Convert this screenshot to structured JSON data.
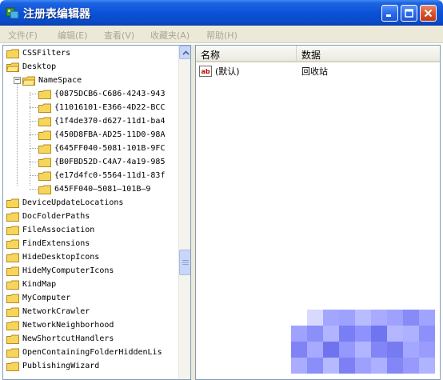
{
  "window": {
    "title": "注册表编辑器",
    "icon": "regedit-icon"
  },
  "menu": [
    "文件(F)",
    "编辑(E)",
    "查看(V)",
    "收藏夹(A)",
    "帮助(H)"
  ],
  "tree": [
    {
      "label": "CSSFilters",
      "level": 0
    },
    {
      "label": "Desktop",
      "level": 0
    },
    {
      "label": "NameSpace",
      "level": 1
    },
    {
      "label": "{0875DCB6-C686-4243-943",
      "level": 2
    },
    {
      "label": "{11016101-E366-4D22-BCC",
      "level": 2
    },
    {
      "label": "{1f4de370-d627-11d1-ba4",
      "level": 2
    },
    {
      "label": "{450D8FBA-AD25-11D0-98A",
      "level": 2
    },
    {
      "label": "{645FF040-5081-101B-9FC",
      "level": 2
    },
    {
      "label": "{B0FBD52D-C4A7-4a19-985",
      "level": 2
    },
    {
      "label": "{e17d4fc0-5564-11d1-83f",
      "level": 2
    },
    {
      "label": "645FF040—5081—101B—9",
      "level": 2
    },
    {
      "label": "DeviceUpdateLocations",
      "level": 0
    },
    {
      "label": "DocFolderPaths",
      "level": 0
    },
    {
      "label": "FileAssociation",
      "level": 0
    },
    {
      "label": "FindExtensions",
      "level": 0
    },
    {
      "label": "HideDesktopIcons",
      "level": 0
    },
    {
      "label": "HideMyComputerIcons",
      "level": 0
    },
    {
      "label": "KindMap",
      "level": 0
    },
    {
      "label": "MyComputer",
      "level": 0
    },
    {
      "label": "NetworkCrawler",
      "level": 0
    },
    {
      "label": "NetworkNeighborhood",
      "level": 0
    },
    {
      "label": "NewShortcutHandlers",
      "level": 0
    },
    {
      "label": "OpenContainingFolderHiddenLis",
      "level": 0
    },
    {
      "label": "PublishingWizard",
      "level": 0
    }
  ],
  "list": {
    "columns": [
      "名称",
      "数据"
    ],
    "rows": [
      {
        "name": "(默认)",
        "data": "回收站",
        "icon": "ab-string-icon"
      }
    ]
  },
  "colors": {
    "titlebar": "#0a52d8",
    "menubar": "#ece9d8",
    "disabled_text": "#a9a696"
  }
}
